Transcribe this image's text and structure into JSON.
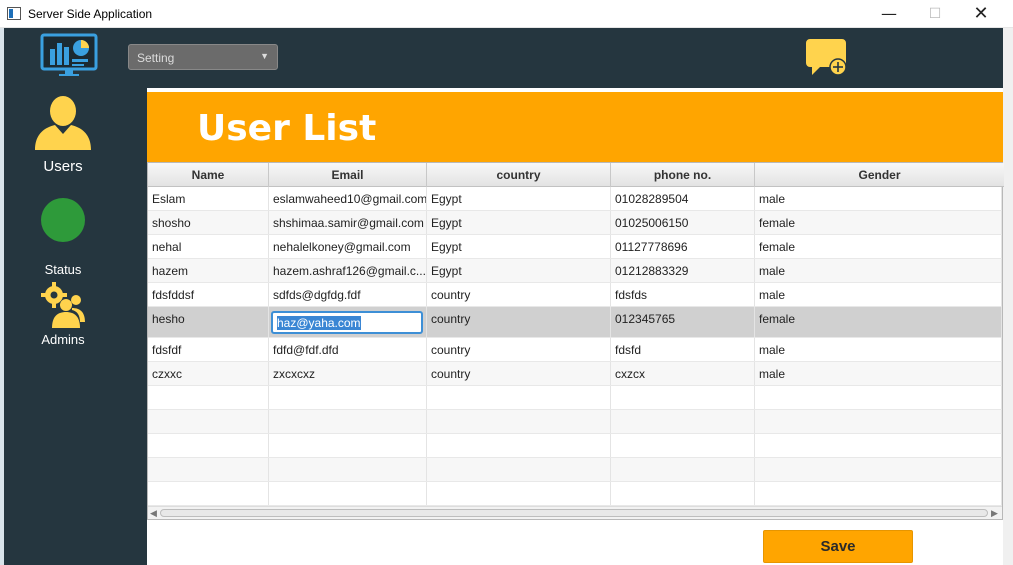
{
  "window": {
    "title": "Server Side Application",
    "minimize": "—",
    "maximize": "☐",
    "close": "✕"
  },
  "sidebar": {
    "items": [
      {
        "label": "Users",
        "icon": "user-icon"
      },
      {
        "label": "Status",
        "icon": "status-dot-icon"
      },
      {
        "label": "Admins",
        "icon": "admins-gear-icon"
      }
    ]
  },
  "toolbar": {
    "setting_value": "Setting",
    "chat_icon": "chat-add-icon"
  },
  "page": {
    "title": "User List"
  },
  "table": {
    "columns": [
      "Name",
      "Email",
      "country",
      "phone no.",
      "Gender"
    ],
    "rows": [
      [
        "Eslam",
        "eslamwaheed10@gmail.com",
        "Egypt",
        "01028289504",
        "male"
      ],
      [
        "shosho",
        "shshimaa.samir@gmail.com",
        "Egypt",
        "01025006150",
        "female"
      ],
      [
        "nehal",
        "nehalelkoney@gmail.com",
        "Egypt",
        "01127778696",
        "female"
      ],
      [
        "hazem",
        "hazem.ashraf126@gmail.c...",
        "Egypt",
        "01212883329",
        "male"
      ],
      [
        "fdsfddsf",
        "sdfds@dgfdg.fdf",
        "country",
        "fdsfds",
        "male"
      ],
      [
        "hesho",
        "haz@yaha.com",
        "country",
        "012345765",
        "female"
      ],
      [
        "fdsfdf",
        "fdfd@fdf.dfd",
        "country",
        "fdsfd",
        "male"
      ],
      [
        "czxxc",
        "zxcxcxz",
        "country",
        "cxzcx",
        "male"
      ]
    ],
    "selected_row": 5,
    "editing_cell_value": "haz@yaha.com"
  },
  "actions": {
    "save_label": "Save"
  },
  "colors": {
    "sidebar_bg": "#25363f",
    "accent": "#ffa500",
    "status_green": "#2e9a3a"
  }
}
